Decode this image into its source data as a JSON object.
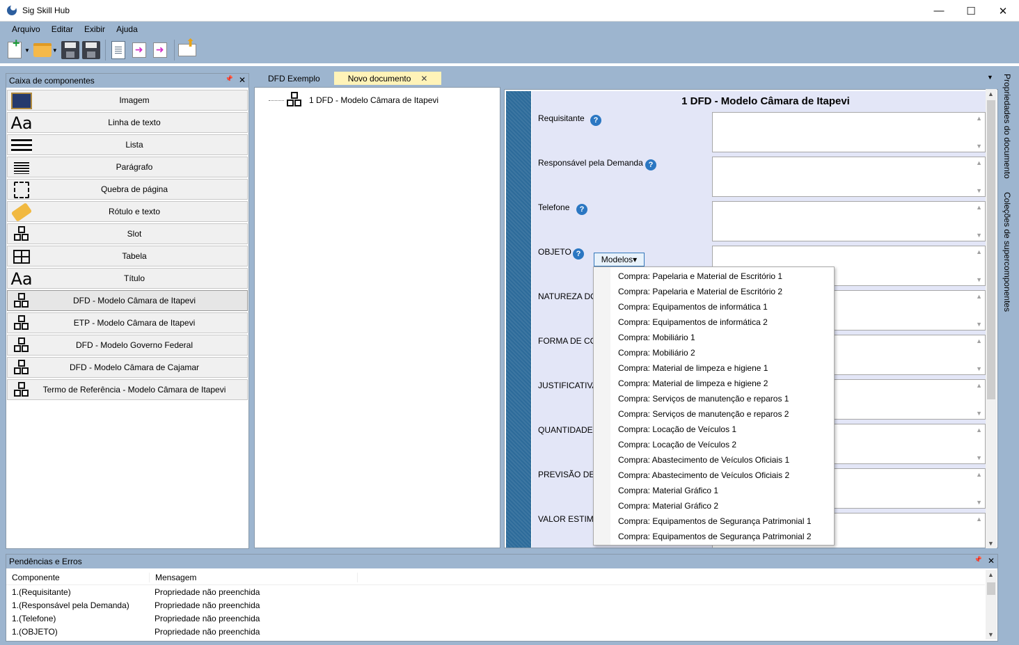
{
  "window": {
    "title": "Sig Skill Hub",
    "minimize": "—",
    "maximize": "☐",
    "close": "✕"
  },
  "menu": [
    "Arquivo",
    "Editar",
    "Exibir",
    "Ajuda"
  ],
  "toolbox": {
    "title": "Caixa de componentes",
    "pin": "📌",
    "close": "✕",
    "items": [
      {
        "label": "Imagem",
        "icon": "image-icon"
      },
      {
        "label": "Linha de texto",
        "icon": "text-line-icon"
      },
      {
        "label": "Lista",
        "icon": "list-icon"
      },
      {
        "label": "Parágrafo",
        "icon": "paragraph-icon"
      },
      {
        "label": "Quebra de página",
        "icon": "page-break-icon"
      },
      {
        "label": "Rótulo e texto",
        "icon": "tag-icon"
      },
      {
        "label": "Slot",
        "icon": "slot-icon"
      },
      {
        "label": "Tabela",
        "icon": "table-icon"
      },
      {
        "label": "Título",
        "icon": "title-icon"
      },
      {
        "label": "DFD - Modelo Câmara de Itapevi",
        "icon": "slot-icon"
      },
      {
        "label": "ETP - Modelo Câmara de Itapevi",
        "icon": "slot-icon"
      },
      {
        "label": "DFD - Modelo Governo Federal",
        "icon": "slot-icon"
      },
      {
        "label": "DFD - Modelo Câmara de Cajamar",
        "icon": "slot-icon"
      },
      {
        "label": "Termo de Referência - Modelo Câmara de Itapevi",
        "icon": "slot-icon"
      }
    ]
  },
  "tabs": [
    {
      "label": "DFD Exemplo",
      "active": false
    },
    {
      "label": "Novo documento",
      "active": true,
      "close": "✕"
    }
  ],
  "tree": {
    "item": "1 DFD - Modelo Câmara de Itapevi"
  },
  "form": {
    "title": "1 DFD - Modelo Câmara de Itapevi",
    "fields": [
      {
        "label": "Requisitante"
      },
      {
        "label": "Responsável pela Demanda"
      },
      {
        "label": "Telefone"
      },
      {
        "label": "OBJETO"
      },
      {
        "label": "NATUREZA DO"
      },
      {
        "label": "FORMA DE CO"
      },
      {
        "label": "JUSTIFICATIVA I"
      },
      {
        "label": "QUANTIDADE"
      },
      {
        "label": "PREVISÃO DE D"
      },
      {
        "label": "VALOR ESTIMA"
      }
    ],
    "help_glyph": "?",
    "modelos_button": "Modelos▾"
  },
  "dropdown": [
    "Compra: Papelaria e Material de Escritório 1",
    "Compra: Papelaria e Material de Escritório 2",
    "Compra: Equipamentos de informática 1",
    "Compra: Equipamentos de informática 2",
    "Compra: Mobiliário 1",
    "Compra: Mobiliário 2",
    "Compra: Material de limpeza e higiene 1",
    "Compra: Material de limpeza e higiene 2",
    "Compra: Serviços de manutenção e reparos 1",
    "Compra: Serviços de manutenção e reparos 2",
    "Compra: Locação de Veículos 1",
    "Compra: Locação de Veículos 2",
    "Compra: Abastecimento de Veículos Oficiais 1",
    "Compra: Abastecimento de Veículos Oficiais 2",
    "Compra: Material Gráfico 1",
    "Compra: Material Gráfico 2",
    "Compra: Equipamentos de Segurança Patrimonial 1",
    "Compra: Equipamentos de Segurança Patrimonial 2"
  ],
  "side_tabs": [
    "Propriedades do documento",
    "Coleções de supercomponentes"
  ],
  "errors": {
    "title": "Pendências e Erros",
    "pin": "📌",
    "close": "✕",
    "columns": [
      "Componente",
      "Mensagem"
    ],
    "rows": [
      {
        "component": "1.(Requisitante)",
        "message": "Propriedade não preenchida"
      },
      {
        "component": "1.(Responsável pela Demanda)",
        "message": "Propriedade não preenchida"
      },
      {
        "component": "1.(Telefone)",
        "message": "Propriedade não preenchida"
      },
      {
        "component": "1.(OBJETO)",
        "message": "Propriedade não preenchida"
      }
    ]
  }
}
